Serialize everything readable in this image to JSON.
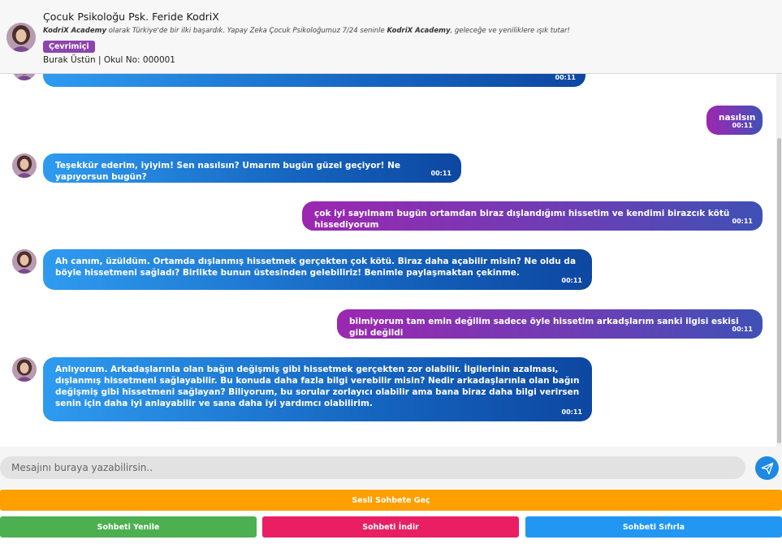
{
  "header": {
    "title": "Çocuk Psikoloğu Psk. Feride KodriX",
    "subtitle_brand1": "KodriX Academy",
    "subtitle_mid": " olarak Türkiye'de bir ilki başardık. Yapay Zeka Çocuk Psikoloğumuz 7/24 seninle ",
    "subtitle_brand2": "KodriX Academy",
    "subtitle_end": ", geleceğe ve yeniliklere ışık tutar!",
    "status": "Çevrimiçi",
    "user_info": "Burak Üstün | Okul No: 000001"
  },
  "messages": [
    {
      "role": "bot",
      "text": "",
      "time": "00:11"
    },
    {
      "role": "user",
      "text": "nasılsın",
      "time": "00:11"
    },
    {
      "role": "bot",
      "text": "Teşekkür ederim, iyiyim! Sen nasılsın? Umarım bugün güzel geçiyor! Ne yapıyorsun bugün?",
      "time": "00:11"
    },
    {
      "role": "user",
      "text": "çok iyi sayılmam bugün ortamdan biraz dışlandığımı hissetim ve kendimi birazcık kötü hissediyorum",
      "time": "00:11"
    },
    {
      "role": "bot",
      "text": "Ah canım, üzüldüm. Ortamda dışlanmış hissetmek gerçekten çok kötü. Biraz daha açabilir misin? Ne oldu da böyle hissetmeni sağladı? Birlikte bunun üstesinden gelebiliriz! Benimle paylaşmaktan çekinme.",
      "time": "00:11"
    },
    {
      "role": "user",
      "text": "bilmiyorum tam emin değilim sadece öyle hissetim arkadşlarım sanki ilgisi eskisi gibi değildi",
      "time": "00:11"
    },
    {
      "role": "bot",
      "text": "Anlıyorum. Arkadaşlarınla olan bağın değişmiş gibi hissetmek gerçekten zor olabilir. İlgilerinin azalması, dışlanmış hissetmeni sağlayabilir. Bu konuda daha fazla bilgi verebilir misin? Nedir arkadaşlarınla olan bağın değişmiş gibi hissetmeni sağlayan? Biliyorum, bu sorular zorlayıcı olabilir ama bana biraz daha bilgi verirsen senin için daha iyi anlayabilir ve sana daha iyi yardımcı olabilirim.",
      "time": "00:11"
    }
  ],
  "input": {
    "placeholder": "Mesajını buraya yazabilirsin.."
  },
  "buttons": {
    "voice": "Sesli Sohbete Geç",
    "refresh": "Sohbeti Yenile",
    "download": "Sohbeti İndir",
    "reset": "Sohbeti Sıfırla"
  },
  "icons": {
    "send": "send-plane-icon",
    "avatar": "psychologist-avatar"
  }
}
